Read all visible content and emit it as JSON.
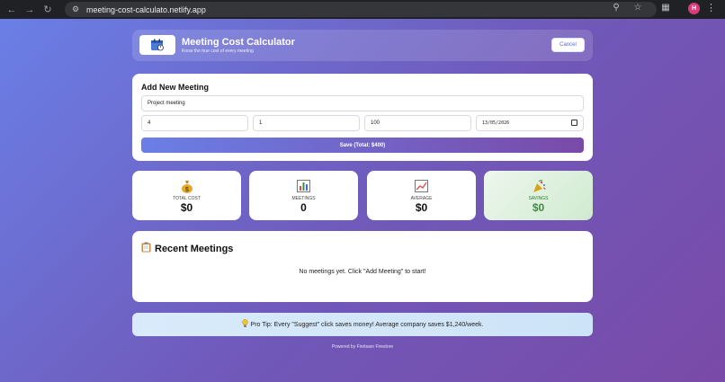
{
  "browser": {
    "url": "meeting-cost-calculato.netlify.app",
    "profile_initial": "H"
  },
  "header": {
    "title": "Meeting Cost Calculator",
    "subtitle": "Know the true cost of every meeting",
    "cancel_label": "Cancel"
  },
  "form": {
    "title": "Add New Meeting",
    "name_value": "Project meeting",
    "attendees_value": "4",
    "duration_value": "1",
    "rate_value": "100",
    "date_value": "13/05/2026",
    "save_label": "Save (Total: $400)"
  },
  "stats": [
    {
      "label": "TOTAL COST",
      "value": "$0",
      "icon": "money-bag-icon"
    },
    {
      "label": "MEETINGS",
      "value": "0",
      "icon": "bar-chart-icon"
    },
    {
      "label": "AVERAGE",
      "value": "$0",
      "icon": "trend-chart-icon"
    },
    {
      "label": "SAVINGS",
      "value": "$0",
      "icon": "party-popper-icon"
    }
  ],
  "recent": {
    "title": "Recent Meetings",
    "empty_message": "No meetings yet. Click \"Add Meeting\" to start!"
  },
  "tip": {
    "text": "Pro Tip: Every \"Suggest\" click saves money! Average company saves $1,240/week."
  },
  "footer": {
    "text": "Powered by Firebase Firestore"
  },
  "colors": {
    "gradient_start": "#6a7fe6",
    "gradient_end": "#7a4aa8",
    "savings_green": "#3b8f3f"
  }
}
